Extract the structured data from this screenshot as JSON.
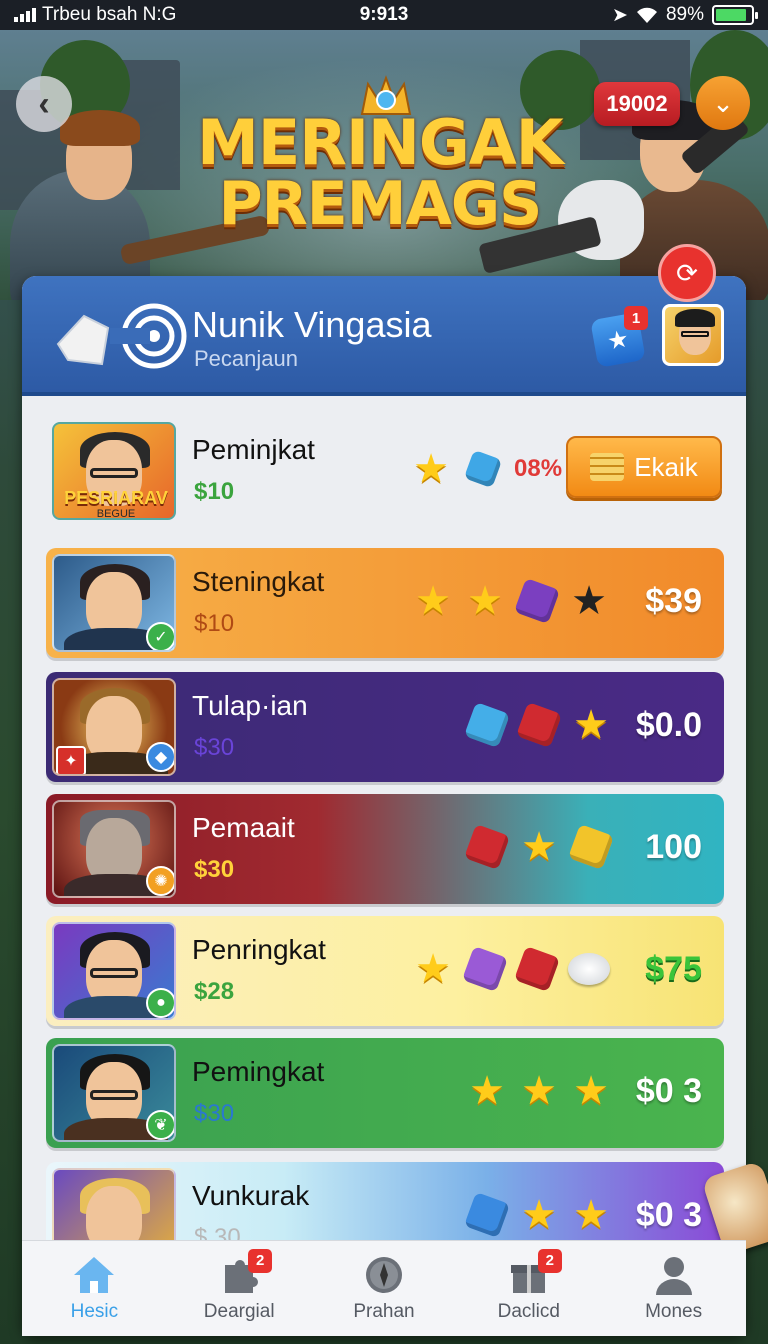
{
  "status_bar": {
    "carrier": "Trbeu bsah N:G",
    "time": "9:913",
    "battery": "89%",
    "battery_level": 0.89
  },
  "header": {
    "coin_count": "19002",
    "title_line1": "MERINGAK",
    "title_line2": "PREMAGS"
  },
  "profile": {
    "name": "Nunik Vingasia",
    "subtitle": "Pecanjaun",
    "notification_count": "1"
  },
  "colors": {
    "panel_header": "#3f73c0",
    "accent_orange": "#f28a14",
    "nav_active": "#3aa0e8",
    "badge_red": "#e8322e"
  },
  "list": [
    {
      "name": "Peminjkat",
      "price": "$10",
      "thumb_text": "PESRIARAV",
      "thumb_subtext": "BEGUE",
      "tokens": [
        "star-gold",
        "cube-blue"
      ],
      "percent": "08%",
      "action_label": "Ekaik"
    },
    {
      "name": "Steningkat",
      "price": "$10",
      "tokens": [
        "star-gold",
        "star-gold",
        "gem-purple",
        "star-dark"
      ],
      "value": "$39"
    },
    {
      "name": "Tulap·ian",
      "price": "$30",
      "tokens": [
        "cube-blue",
        "cube-red",
        "star-gold"
      ],
      "value": "$0.0"
    },
    {
      "name": "Pemaait",
      "price": "$30",
      "tokens": [
        "cube-red",
        "star-gold",
        "cube-yellow"
      ],
      "value": "100"
    },
    {
      "name": "Penringkat",
      "price": "$28",
      "tokens": [
        "star-gold",
        "cube-purple",
        "cube-red",
        "disc-white"
      ],
      "value": "$75"
    },
    {
      "name": "Pemingkat",
      "price": "$30",
      "tokens": [
        "star-gold",
        "star-gold",
        "star-gold"
      ],
      "value": "$0 3"
    },
    {
      "name": "Vunkurak",
      "price": "$ 30",
      "tokens": [
        "cube-blue",
        "star-gold",
        "star-gold"
      ],
      "value": "$0 3"
    }
  ],
  "nav": [
    {
      "label": "Hesic",
      "icon": "home-icon",
      "active": true
    },
    {
      "label": "Deargial",
      "icon": "puzzle-icon",
      "badge": "2"
    },
    {
      "label": "Prahan",
      "icon": "compass-icon"
    },
    {
      "label": "Daclicd",
      "icon": "gift-icon",
      "badge": "2"
    },
    {
      "label": "Mones",
      "icon": "profile-icon"
    }
  ]
}
